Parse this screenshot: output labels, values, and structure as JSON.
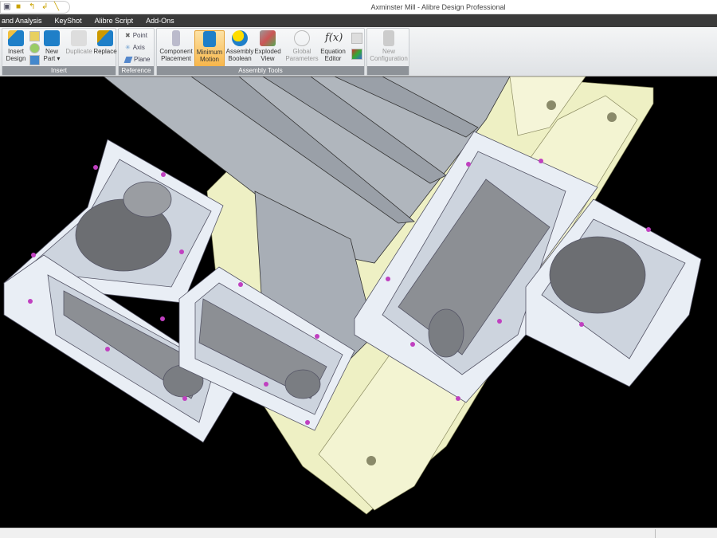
{
  "window": {
    "title": "Axminster Mill - Alibre Design Professional"
  },
  "tabs": [
    "and Analysis",
    "KeyShot",
    "Alibre Script",
    "Add-Ons"
  ],
  "ribbon": {
    "insert": {
      "label": "Insert",
      "insert_design": [
        "Insert",
        "Design"
      ],
      "new_part": [
        "New",
        "Part ▾"
      ],
      "duplicate": "Duplicate",
      "replace": "Replace"
    },
    "reference": {
      "label": "Reference",
      "point": "Point",
      "axis": "Axis",
      "plane": "Plane"
    },
    "assembly_tools": {
      "label": "Assembly Tools",
      "component_placement": [
        "Component",
        "Placement"
      ],
      "minimum_motion": [
        "Minimum",
        "Motion"
      ],
      "assembly_boolean": [
        "Assembly",
        "Boolean"
      ],
      "exploded_view": [
        "Exploded",
        "View"
      ],
      "global_parameters": [
        "Global",
        "Parameters"
      ],
      "equation_editor": [
        "Equation",
        "Editor"
      ]
    },
    "config": {
      "new_configuration": [
        "New",
        "Configuration"
      ]
    }
  },
  "colors": {
    "accent": "#f7b64a",
    "viewport_bg": "#000000",
    "base": "#eef0c4",
    "box": "#e9eef5"
  }
}
